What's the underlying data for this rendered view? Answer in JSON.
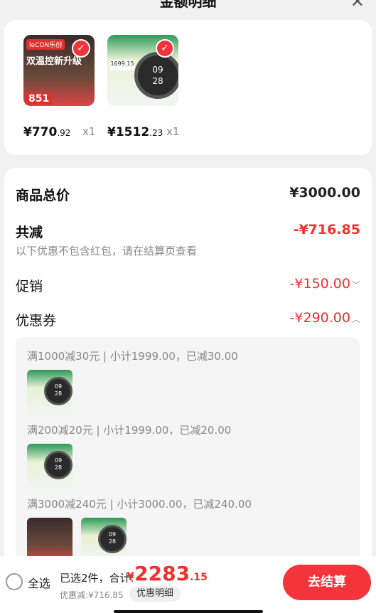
{
  "header": {
    "title": "金额明细",
    "close_icon": "close-icon"
  },
  "items": [
    {
      "thumb_label": "leCON乐创",
      "thumb_headline": "双温控新升级",
      "thumb_price": "851",
      "price_int": "¥770",
      "price_dec": ".92",
      "qty": "x1"
    },
    {
      "thumb_tag": "1699.15",
      "watch_time_h": "09",
      "watch_time_m": "28",
      "price_int": "¥1512",
      "price_dec": ".23",
      "qty": "x1"
    }
  ],
  "summary": {
    "total_label": "商品总价",
    "total_value": "¥3000.00",
    "reduce_label": "共减",
    "reduce_value": "-¥716.85",
    "note": "以下优惠不包含红包，请在结算页查看",
    "promo_label": "促销",
    "promo_value": "-¥150.00",
    "coupon_label": "优惠券",
    "coupon_value": "-¥290.00",
    "chevron_down": "﹀",
    "chevron_up": "︿"
  },
  "coupons": [
    {
      "text": "满1000减30元 | 小计1999.00，已减30.00"
    },
    {
      "text": "满200减20元 | 小计1999.00，已减20.00"
    },
    {
      "text": "满3000减240元 | 小计3000.00，已减240.00"
    }
  ],
  "mini": {
    "h": "09",
    "m": "28"
  },
  "bottom": {
    "select_all": "全选",
    "summary": "已选2件，合计:",
    "currency": "¥",
    "total_int": "2283",
    "total_dec": ".15",
    "discount": "优惠减:¥716.85",
    "detail_button": "优惠明细",
    "checkout": "去结算"
  },
  "colors": {
    "accent": "#f23030",
    "button": "#f5333b"
  }
}
